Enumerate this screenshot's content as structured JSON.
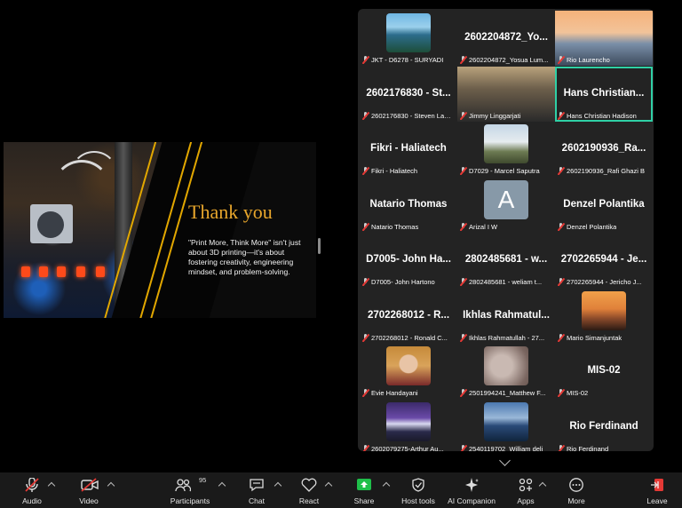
{
  "slide": {
    "title": "Thank you",
    "body": "\"Print More, Think More\" isn't just about 3D printing—it's about fostering creativity, engineering mindset, and problem-solving."
  },
  "tiles": [
    {
      "name": "",
      "footer": "JKT - D6278 - SURYADI",
      "picture": "lake"
    },
    {
      "name": "2602204872_Yo...",
      "footer": "2602204872_Yosua Lum...",
      "picture": ""
    },
    {
      "name": "",
      "footer": "Rio Laurencho",
      "picture": "bridge"
    },
    {
      "name": "2602176830 - St...",
      "footer": "2602176830 - Steven Lawr...",
      "picture": ""
    },
    {
      "name": "",
      "footer": "Jimmy Linggarjati",
      "picture": "camera"
    },
    {
      "name": "Hans Christian...",
      "footer": "Hans Christian Hadison",
      "picture": ""
    },
    {
      "name": "Fikri - Haliatech",
      "footer": "Fikri - Haliatech",
      "picture": ""
    },
    {
      "name": "",
      "footer": "D7029 - Marcel Saputra",
      "picture": "man"
    },
    {
      "name": "2602190936_Ra...",
      "footer": "2602190936_Rafi Ghazi B",
      "picture": ""
    },
    {
      "name": "Natario Thomas",
      "footer": "Natario Thomas",
      "picture": ""
    },
    {
      "name": "",
      "footer": "Arizal I W",
      "picture": "avatar",
      "initial": "A"
    },
    {
      "name": "Denzel Polantika",
      "footer": "Denzel Polantika",
      "picture": ""
    },
    {
      "name": "D7005- John Ha...",
      "footer": "D7005- John Hartono",
      "picture": ""
    },
    {
      "name": "2802485681 - w...",
      "footer": "2802485681 - weliam t...",
      "picture": ""
    },
    {
      "name": "2702265944 - Je...",
      "footer": "2702265944 - Jericho J...",
      "picture": ""
    },
    {
      "name": "2702268012 - R...",
      "footer": "2702268012 - Ronald C...",
      "picture": ""
    },
    {
      "name": "Ikhlas Rahmatul...",
      "footer": "Ikhlas Rahmatullah - 27...",
      "picture": ""
    },
    {
      "name": "",
      "footer": "Mario Simanjuntak",
      "picture": "sunset"
    },
    {
      "name": "",
      "footer": "Evie Handayani",
      "picture": "woman"
    },
    {
      "name": "",
      "footer": "2501994241_Matthew F...",
      "picture": "blur"
    },
    {
      "name": "MIS-02",
      "footer": "MIS-02",
      "picture": ""
    },
    {
      "name": "",
      "footer": "2602079275-Arthur Au...",
      "picture": "mountain"
    },
    {
      "name": "",
      "footer": "2540119702_William deli",
      "picture": "lake2"
    },
    {
      "name": "Rio Ferdinand",
      "footer": "Rio Ferdinand",
      "picture": ""
    }
  ],
  "toolbar": {
    "audio": "Audio",
    "video": "Video",
    "participants": "Participants",
    "participants_count": "95",
    "chat": "Chat",
    "react": "React",
    "share": "Share",
    "host_tools": "Host tools",
    "ai_companion": "AI Companion",
    "apps": "Apps",
    "more": "More",
    "leave": "Leave"
  },
  "colors": {
    "accent": "#2fd0a6",
    "share_green": "#1fbf4a",
    "mute_red": "#e53935",
    "leave_red": "#e53935",
    "slide_title": "#e8a62c"
  }
}
